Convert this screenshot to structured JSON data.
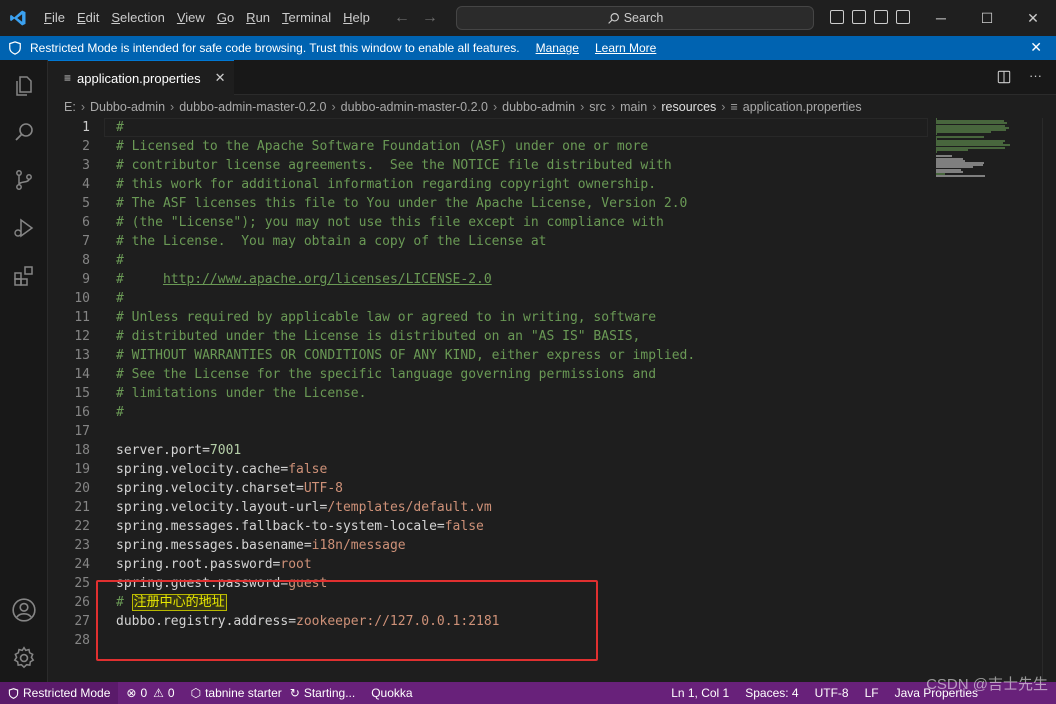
{
  "menu": [
    "File",
    "Edit",
    "Selection",
    "View",
    "Go",
    "Run",
    "Terminal",
    "Help"
  ],
  "search": {
    "label": "Search"
  },
  "banner": {
    "message": "Restricted Mode is intended for safe code browsing. Trust this window to enable all features.",
    "manage": "Manage",
    "learn_more": "Learn More"
  },
  "tab": {
    "label": "application.properties"
  },
  "breadcrumb": [
    "E:",
    "Dubbo-admin",
    "dubbo-admin-master-0.2.0",
    "dubbo-admin-master-0.2.0",
    "dubbo-admin",
    "src",
    "main",
    "resources",
    "application.properties"
  ],
  "editor": {
    "current_line": 1,
    "lines": [
      "#",
      "# Licensed to the Apache Software Foundation (ASF) under one or more",
      "# contributor license agreements.  See the NOTICE file distributed with",
      "# this work for additional information regarding copyright ownership.",
      "# The ASF licenses this file to You under the Apache License, Version 2.0",
      "# (the \"License\"); you may not use this file except in compliance with",
      "# the License.  You may obtain a copy of the License at",
      "#",
      "#     http://www.apache.org/licenses/LICENSE-2.0",
      "#",
      "# Unless required by applicable law or agreed to in writing, software",
      "# distributed under the License is distributed on an \"AS IS\" BASIS,",
      "# WITHOUT WARRANTIES OR CONDITIONS OF ANY KIND, either express or implied.",
      "# See the License for the specific language governing permissions and",
      "# limitations under the License.",
      "#",
      "",
      "server.port=7001",
      "spring.velocity.cache=false",
      "spring.velocity.charset=UTF-8",
      "spring.velocity.layout-url=/templates/default.vm",
      "spring.messages.fallback-to-system-locale=false",
      "spring.messages.basename=i18n/message",
      "spring.root.password=root",
      "spring.guest.password=guest",
      "# 注册中心的地址",
      "dubbo.registry.address=zookeeper://127.0.0.1:2181",
      ""
    ]
  },
  "status": {
    "restricted": "Restricted Mode",
    "errors": "0",
    "warnings": "0",
    "tabnine": "tabnine starter",
    "starting": "Starting...",
    "quokka": "Quokka",
    "position": "Ln 1, Col 1",
    "spaces": "Spaces: 4",
    "encoding": "UTF-8",
    "eol": "LF",
    "language": "Java Properties"
  },
  "watermark": "CSDN @吉士先生",
  "colors": {
    "banner": "#0063b1",
    "statusbar": "#68217a",
    "comment": "#6a9955",
    "value": "#ce9178",
    "number": "#b5cea8",
    "annotation_box": "#e03030"
  }
}
